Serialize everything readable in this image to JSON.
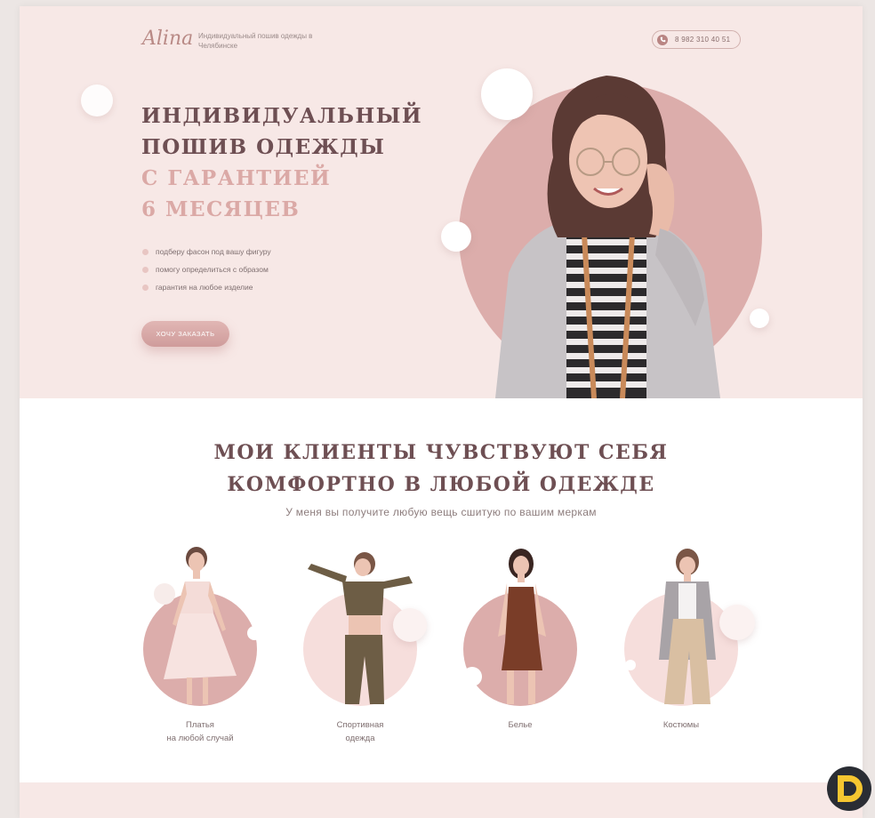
{
  "header": {
    "logo": "Alina",
    "tagline": "Индивидуальный пошив одежды в Челябинске",
    "phone": "8 982 310 40 51",
    "phone_icon": "phone-icon"
  },
  "hero": {
    "title_lines": [
      "ИНДИВИДУАЛЬНЫЙ",
      "ПОШИВ ОДЕЖДЫ"
    ],
    "accent_lines": [
      "С ГАРАНТИЕЙ",
      "6 МЕСЯЦЕВ"
    ],
    "bullets": [
      "подберу фасон под вашу фигуру",
      "помогу определиться с образом",
      "гарантия на любое изделие"
    ],
    "cta_label": "ХОЧУ ЗАКАЗАТЬ"
  },
  "clients": {
    "title_lines": [
      "МОИ КЛИЕНТЫ ЧУВСТВУЮТ СЕБЯ",
      "КОМФОРТНО В ЛЮБОЙ ОДЕЖДЕ"
    ],
    "subtitle": "У меня вы получите любую вещь сшитую по вашим меркам",
    "categories": [
      {
        "line1": "Платья",
        "line2": "на любой случай"
      },
      {
        "line1": "Спортивная",
        "line2": "одежда"
      },
      {
        "line1": "Белье",
        "line2": ""
      },
      {
        "line1": "Костюмы",
        "line2": ""
      }
    ]
  },
  "colors": {
    "brand_dark": "#6e4f53",
    "brand_accent": "#dba9a6",
    "hero_bg": "#f7e8e6"
  }
}
